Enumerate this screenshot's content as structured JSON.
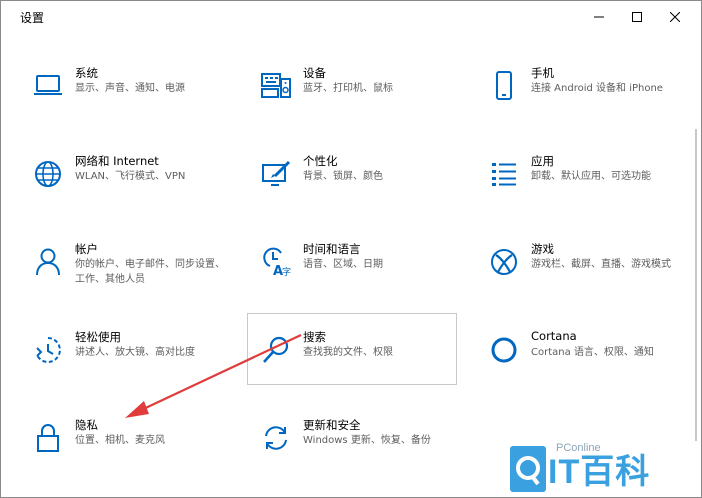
{
  "window": {
    "title": "设置",
    "accent_color": "#0067c0"
  },
  "icons": {
    "minimize": "minimize-icon",
    "maximize": "maximize-icon",
    "close": "close-icon"
  },
  "settings": [
    {
      "name": "系统",
      "desc": "显示、声音、通知、电源",
      "icon": "laptop-icon"
    },
    {
      "name": "设备",
      "desc": "蓝牙、打印机、鼠标",
      "icon": "keyboard-speaker-icon"
    },
    {
      "name": "手机",
      "desc": "连接 Android 设备和 iPhone",
      "icon": "phone-icon"
    },
    {
      "name": "网络和 Internet",
      "desc": "WLAN、飞行模式、VPN",
      "icon": "globe-icon"
    },
    {
      "name": "个性化",
      "desc": "背景、锁屏、颜色",
      "icon": "paint-icon"
    },
    {
      "name": "应用",
      "desc": "卸载、默认应用、可选功能",
      "icon": "apps-list-icon"
    },
    {
      "name": "帐户",
      "desc": "你的帐户、电子邮件、同步设置、工作、其他人员",
      "icon": "person-icon"
    },
    {
      "name": "时间和语言",
      "desc": "语音、区域、日期",
      "icon": "time-language-icon"
    },
    {
      "name": "游戏",
      "desc": "游戏栏、截屏、直播、游戏模式",
      "icon": "xbox-icon"
    },
    {
      "name": "轻松使用",
      "desc": "讲述人、放大镜、高对比度",
      "icon": "ease-of-access-icon"
    },
    {
      "name": "搜索",
      "desc": "查找我的文件、权限",
      "icon": "search-icon"
    },
    {
      "name": "Cortana",
      "desc": "Cortana 语言、权限、通知",
      "icon": "cortana-icon"
    },
    {
      "name": "隐私",
      "desc": "位置、相机、麦克风",
      "icon": "lock-icon"
    },
    {
      "name": "更新和安全",
      "desc": "Windows 更新、恢复、备份",
      "icon": "update-icon"
    }
  ],
  "annotation": {
    "arrow_color": "#e03c3c"
  },
  "watermark": {
    "brand": "PConline",
    "name": "IT百科"
  }
}
